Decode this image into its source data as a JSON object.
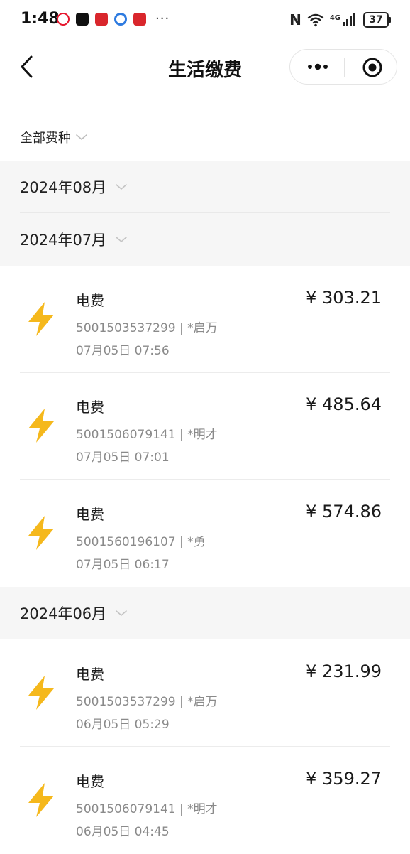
{
  "status": {
    "time": "1:48",
    "more": "···",
    "network": "4G",
    "battery": "37"
  },
  "nav": {
    "title": "生活缴费"
  },
  "filter": {
    "label": "全部费种"
  },
  "months": [
    {
      "label": "2024年08月"
    },
    {
      "label": "2024年07月"
    },
    {
      "label": "2024年06月"
    }
  ],
  "records": [
    {
      "type": "电费",
      "account": "5001503537299 | *启万",
      "date": "07月05日 07:56",
      "amount": "¥ 303.21"
    },
    {
      "type": "电费",
      "account": "5001506079141 | *明才",
      "date": "07月05日 07:01",
      "amount": "¥ 485.64"
    },
    {
      "type": "电费",
      "account": "5001560196107 | *勇",
      "date": "07月05日 06:17",
      "amount": "¥ 574.86"
    },
    {
      "type": "电费",
      "account": "5001503537299 | *启万",
      "date": "06月05日 05:29",
      "amount": "¥ 231.99"
    },
    {
      "type": "电费",
      "account": "5001506079141 | *明才",
      "date": "06月05日 04:45",
      "amount": "¥ 359.27"
    }
  ],
  "colors": {
    "bolt": "#f5b81c",
    "month_bg": "#f6f6f6"
  },
  "icons": {
    "record": "lightning-bolt-icon"
  }
}
